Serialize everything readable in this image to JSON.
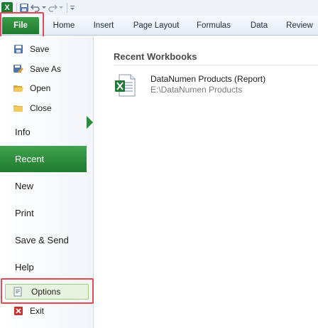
{
  "qat": {
    "excel_letter": "X"
  },
  "tabs": [
    "File",
    "Home",
    "Insert",
    "Page Layout",
    "Formulas",
    "Data",
    "Review"
  ],
  "nav": {
    "small_items": [
      "Save",
      "Save As",
      "Open",
      "Close"
    ],
    "big_items": [
      "Info",
      "Recent",
      "New",
      "Print",
      "Save & Send",
      "Help"
    ],
    "options": "Options",
    "exit": "Exit"
  },
  "recent": {
    "title": "Recent Workbooks",
    "workbooks": [
      {
        "name": "DataNumen Products (Report)",
        "path": "E:\\DataNumen Products"
      }
    ]
  },
  "colors": {
    "accent_green": "#1f7a2e",
    "highlight_red": "#e04a55"
  }
}
